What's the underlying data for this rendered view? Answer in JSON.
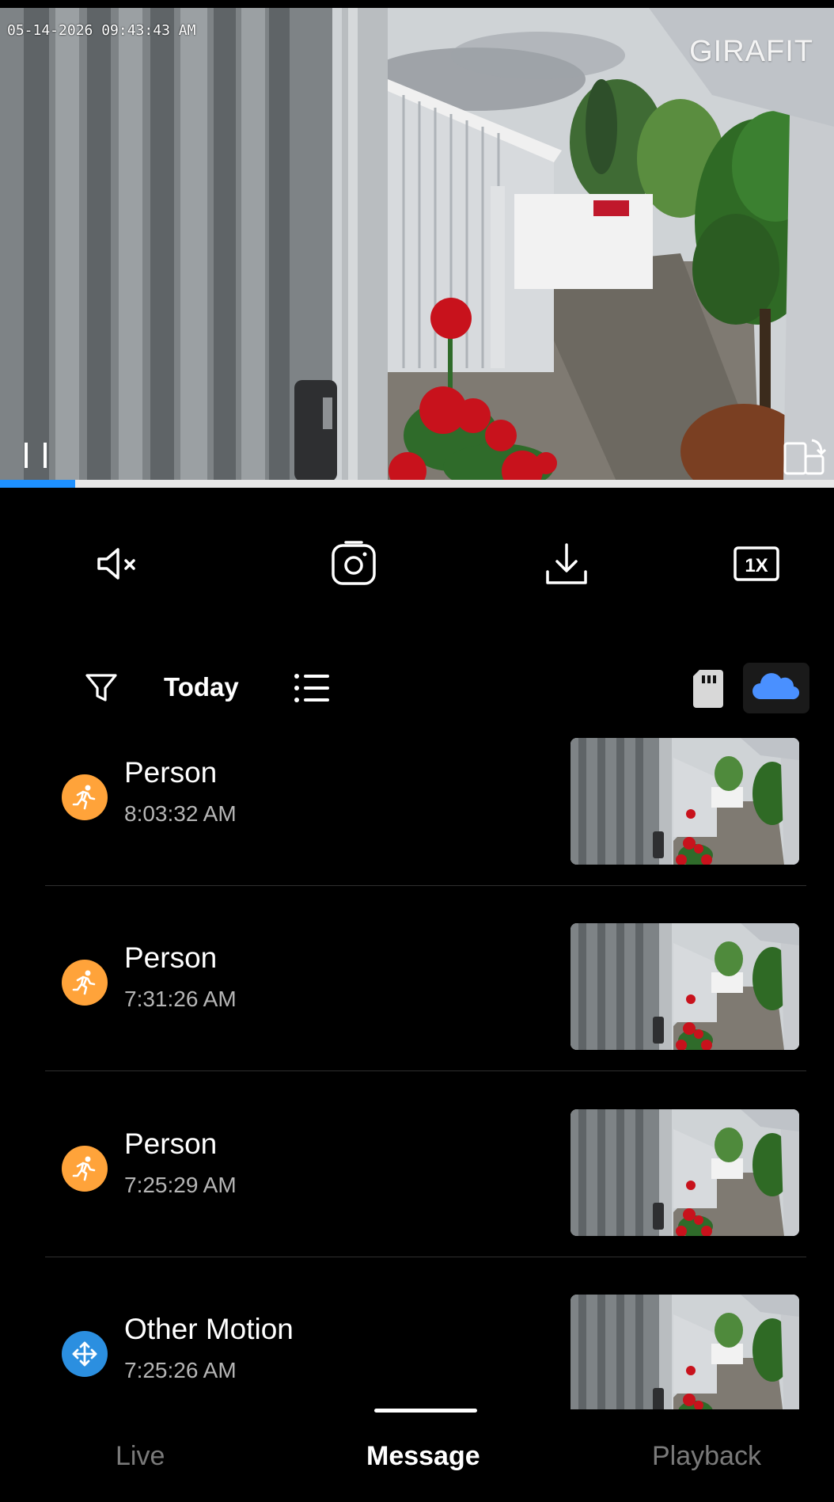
{
  "player": {
    "timestamp": "05-14-2026 09:43:43 AM",
    "brand": "GIRAFIT",
    "progress": 0.09
  },
  "controls": {
    "mute_icon": "speaker-mute-icon",
    "screenshot_icon": "camera-icon",
    "download_icon": "download-icon",
    "speed_label": "1X"
  },
  "filter": {
    "date_label": "Today",
    "accent": "#4a90ff"
  },
  "events": [
    {
      "title": "Person",
      "time": "8:03:32 AM",
      "type": "person",
      "color": "#ffa33a"
    },
    {
      "title": "Person",
      "time": "7:31:26 AM",
      "type": "person",
      "color": "#ffa33a"
    },
    {
      "title": "Person",
      "time": "7:25:29 AM",
      "type": "person",
      "color": "#ffa33a"
    },
    {
      "title": "Other Motion",
      "time": "7:25:26 AM",
      "type": "motion",
      "color": "#2b8fe0"
    }
  ],
  "nav": {
    "live": "Live",
    "message": "Message",
    "playback": "Playback",
    "active": "message"
  }
}
